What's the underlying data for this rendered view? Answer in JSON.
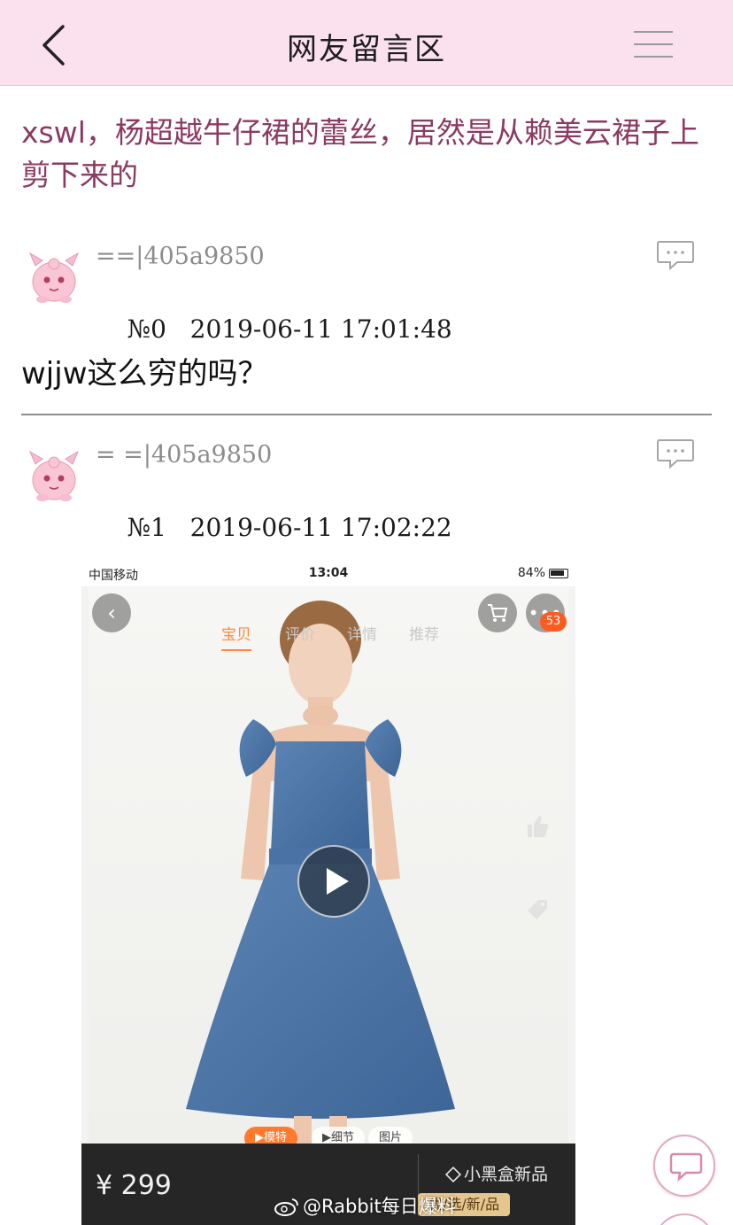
{
  "header": {
    "title": "网友留言区"
  },
  "post": {
    "title": "xswl，杨超越牛仔裙的蕾丝，居然是从赖美云裙子上剪下来的"
  },
  "replies": [
    {
      "username": "==|405a9850",
      "floor": "№0",
      "timestamp": "2019-06-11 17:01:48",
      "body": "wjjw这么穷的吗？"
    },
    {
      "username": "= =|405a9850",
      "floor": "№1",
      "timestamp": "2019-06-11 17:02:22",
      "body": ""
    }
  ],
  "attachment": {
    "status_bar": {
      "carrier": "中国移动",
      "time": "13:04",
      "battery": "84%"
    },
    "product_tabs": [
      "宝贝",
      "评价",
      "详情",
      "推荐"
    ],
    "cart_badge": "53",
    "media_tabs": [
      "▶模特",
      "▶细节",
      "图片"
    ],
    "price": "¥ 299",
    "brand_box": "小黑盒新品",
    "brand_tag": "优/选/新/品"
  },
  "watermark": "@Rabbit每日爆料",
  "icons": {
    "back": "chevron-left-icon",
    "menu": "hamburger-menu-icon",
    "comment": "comment-bubble-icon",
    "avatar": "pink-creature-avatar",
    "play": "play-icon",
    "cart": "cart-icon",
    "more": "more-dots-icon"
  },
  "colors": {
    "header_bg": "#fbe0ee",
    "title_text": "#8b3a62",
    "accent_orange": "#ff7a2c"
  }
}
